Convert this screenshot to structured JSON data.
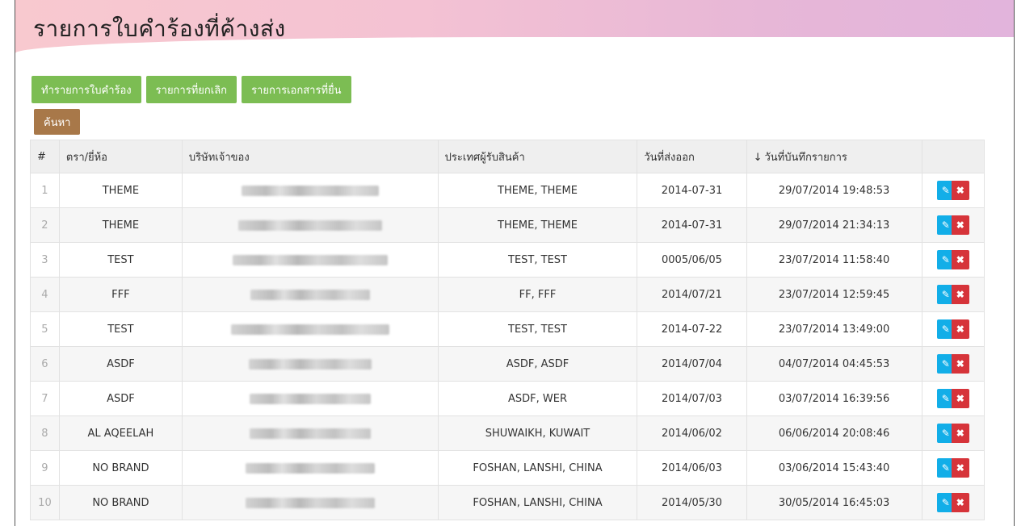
{
  "page": {
    "title": "รายการใบคำร้องที่ค้างส่ง"
  },
  "toolbar": {
    "create_label": "ทำรายการใบคำร้อง",
    "cancelled_label": "รายการที่ยกเลิก",
    "submitted_label": "รายการเอกสารที่ยื่น",
    "search_label": "ค้นหา"
  },
  "table": {
    "headers": {
      "num": "#",
      "brand": "ตรา/ยี่ห้อ",
      "owner": "บริษัทเจ้าของ",
      "country": "ประเทศผู้รับสินค้า",
      "ship_date": "วันที่ส่งออก",
      "sort_arrow": "↓",
      "record_date": "วันที่บันทึกรายการ"
    },
    "rows": [
      {
        "num": "1",
        "brand": "THEME",
        "country": "THEME, THEME",
        "ship_date": "2014-07-31",
        "record_date": "29/07/2014 19:48:53"
      },
      {
        "num": "2",
        "brand": "THEME",
        "country": "THEME, THEME",
        "ship_date": "2014-07-31",
        "record_date": "29/07/2014 21:34:13"
      },
      {
        "num": "3",
        "brand": "TEST",
        "country": "TEST, TEST",
        "ship_date": "0005/06/05",
        "record_date": "23/07/2014 11:58:40"
      },
      {
        "num": "4",
        "brand": "FFF",
        "country": "FF, FFF",
        "ship_date": "2014/07/21",
        "record_date": "23/07/2014 12:59:45"
      },
      {
        "num": "5",
        "brand": "TEST",
        "country": "TEST, TEST",
        "ship_date": "2014-07-22",
        "record_date": "23/07/2014 13:49:00"
      },
      {
        "num": "6",
        "brand": "ASDF",
        "country": "ASDF, ASDF",
        "ship_date": "2014/07/04",
        "record_date": "04/07/2014 04:45:53"
      },
      {
        "num": "7",
        "brand": "ASDF",
        "country": "ASDF, WER",
        "ship_date": "2014/07/03",
        "record_date": "03/07/2014 16:39:56"
      },
      {
        "num": "8",
        "brand": "AL AQEELAH",
        "country": "SHUWAIKH, KUWAIT",
        "ship_date": "2014/06/02",
        "record_date": "06/06/2014 20:08:46"
      },
      {
        "num": "9",
        "brand": "NO BRAND",
        "country": "FOSHAN, LANSHI, CHINA",
        "ship_date": "2014/06/03",
        "record_date": "03/06/2014 15:43:40"
      },
      {
        "num": "10",
        "brand": "NO BRAND",
        "country": "FOSHAN, LANSHI, CHINA",
        "ship_date": "2014/05/30",
        "record_date": "30/05/2014 16:45:03"
      }
    ],
    "actions": {
      "edit_icon": "pencil-icon",
      "delete_icon": "close-icon",
      "edit_color": "#12aee8",
      "delete_color": "#d6343a"
    }
  },
  "colors": {
    "green_button": "#7cbd53",
    "brown_button": "#a87849"
  }
}
